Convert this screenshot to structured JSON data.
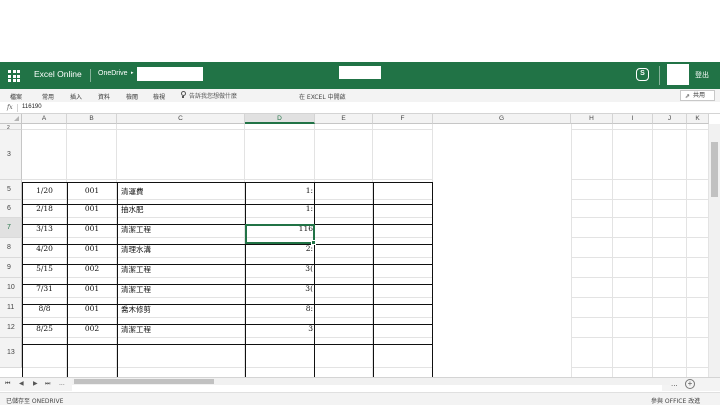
{
  "app": {
    "name": "Excel Online",
    "location": "OneDrive",
    "sign_out": "登出"
  },
  "menu": {
    "items": [
      "檔案",
      "常用",
      "插入",
      "資料",
      "檢閱",
      "檢視"
    ],
    "tell_me": "告訴我您想做什麼",
    "open_in_excel": "在 EXCEL 中開啟",
    "share": "共用"
  },
  "formula": {
    "fx": "fx",
    "value": "116190"
  },
  "grid": {
    "columns": [
      "A",
      "B",
      "C",
      "D",
      "E",
      "F",
      "G",
      "H",
      "I",
      "J",
      "K"
    ],
    "selected_column": "D",
    "rows": [
      {
        "num": "2",
        "date": "",
        "code": "",
        "item": "",
        "amount": ""
      },
      {
        "num": "3",
        "date": "",
        "code": "",
        "item": "",
        "amount": ""
      },
      {
        "num": "5",
        "date": "1/20",
        "code": "001",
        "item": "清運費",
        "amount": "1:"
      },
      {
        "num": "6",
        "date": "2/18",
        "code": "001",
        "item": "抽水肥",
        "amount": "1:"
      },
      {
        "num": "7",
        "date": "3/13",
        "code": "001",
        "item": "清潔工程",
        "amount": "116"
      },
      {
        "num": "8",
        "date": "4/20",
        "code": "001",
        "item": "清理水溝",
        "amount": "2:"
      },
      {
        "num": "9",
        "date": "5/15",
        "code": "002",
        "item": "清潔工程",
        "amount": "3("
      },
      {
        "num": "10",
        "date": "7/31",
        "code": "001",
        "item": "清潔工程",
        "amount": "3("
      },
      {
        "num": "11",
        "date": "8/8",
        "code": "001",
        "item": "喬木修剪",
        "amount": "8:"
      },
      {
        "num": "12",
        "date": "8/25",
        "code": "002",
        "item": "清潔工程",
        "amount": "3"
      },
      {
        "num": "13",
        "date": "",
        "code": "",
        "item": "",
        "amount": ""
      }
    ],
    "selected_row": "7"
  },
  "sheetbar": {
    "more": "..."
  },
  "status": {
    "saved": "已儲存至 ONEDRIVE",
    "help": "參與 OFFICE 改進"
  },
  "colors": {
    "accent": "#217346"
  }
}
